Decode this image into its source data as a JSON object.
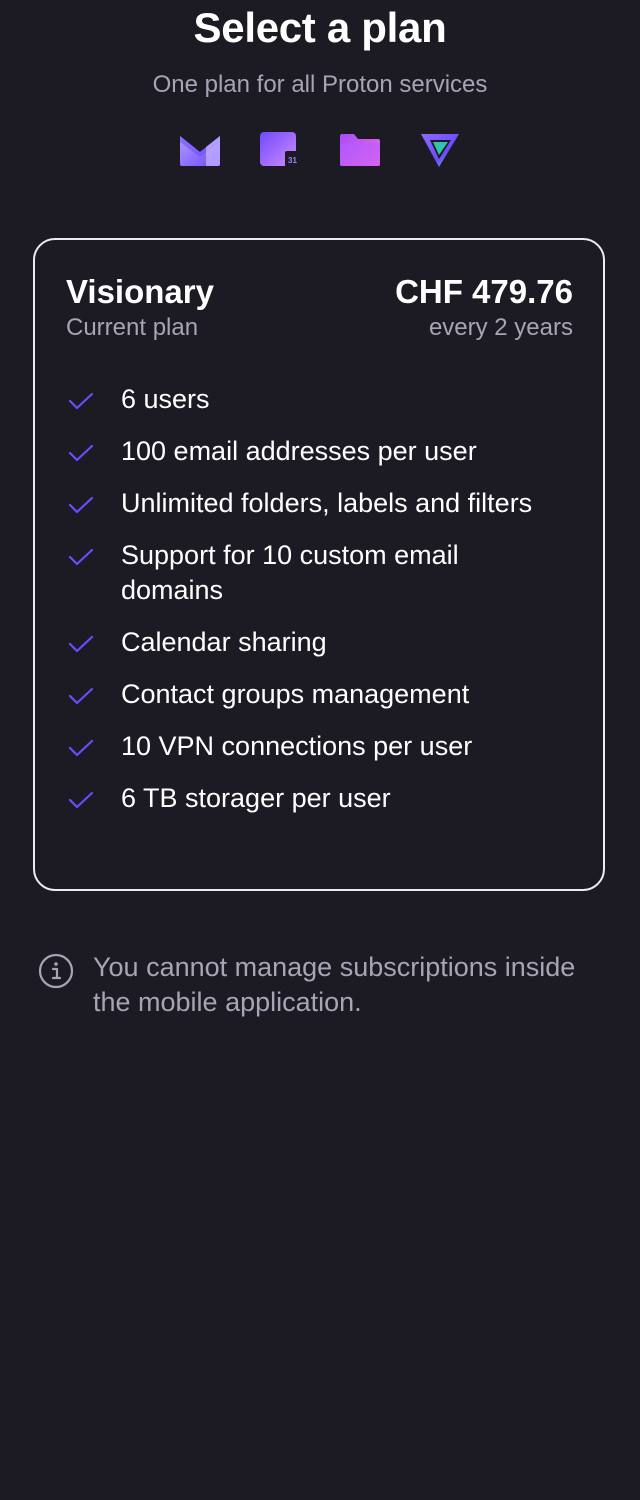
{
  "header": {
    "title": "Select a plan",
    "subtitle": "One plan for all Proton services",
    "product_icons": [
      "proton-mail-icon",
      "proton-calendar-icon",
      "proton-drive-icon",
      "proton-vpn-icon"
    ],
    "calendar_icon_day": "31"
  },
  "plan": {
    "name": "Visionary",
    "status": "Current plan",
    "price": "CHF 479.76",
    "period": "every 2 years",
    "features": [
      "6 users",
      "100 email addresses per user",
      "Unlimited folders, labels and filters",
      "Support for 10 custom email domains",
      "Calendar sharing",
      "Contact groups management",
      "10 VPN connections per user",
      "6 TB storager per user"
    ]
  },
  "notice": {
    "text": "You cannot manage subscriptions inside the mobile application."
  },
  "colors": {
    "background": "#1c1b24",
    "accent": "#6d4aff",
    "muted_text": "#a7a4b5",
    "card_border": "#ebebf0"
  }
}
